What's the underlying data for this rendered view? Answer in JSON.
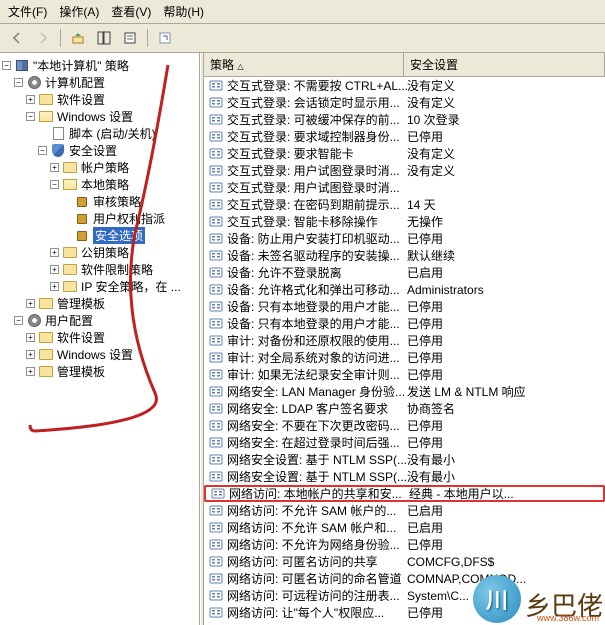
{
  "menu": {
    "file": "文件(F)",
    "action": "操作(A)",
    "view": "查看(V)",
    "help": "帮助(H)"
  },
  "tree": {
    "root": "\"本地计算机\" 策略",
    "computer": "计算机配置",
    "sw1": "软件设置",
    "win1": "Windows 设置",
    "script": "脚本 (启动/关机)",
    "sec": "安全设置",
    "acct": "帐户策略",
    "local": "本地策略",
    "audit": "审核策略",
    "rights": "用户权利指派",
    "secopt": "安全选项",
    "pubkey": "公钥策略",
    "swres": "软件限制策略",
    "ipsec": "IP 安全策略，在 ...",
    "admin1": "管理模板",
    "user": "用户配置",
    "sw2": "软件设置",
    "win2": "Windows 设置",
    "admin2": "管理模板"
  },
  "columns": {
    "policy": "策略  ",
    "setting": "安全设置"
  },
  "rows": [
    {
      "name": "交互式登录: 不需要按 CTRL+AL...",
      "val": "没有定义"
    },
    {
      "name": "交互式登录: 会话锁定时显示用...",
      "val": "没有定义"
    },
    {
      "name": "交互式登录: 可被缓冲保存的前...",
      "val": "10 次登录"
    },
    {
      "name": "交互式登录: 要求域控制器身份...",
      "val": "已停用"
    },
    {
      "name": "交互式登录: 要求智能卡",
      "val": "没有定义"
    },
    {
      "name": "交互式登录: 用户试图登录时消...",
      "val": "没有定义"
    },
    {
      "name": "交互式登录: 用户试图登录时消...",
      "val": ""
    },
    {
      "name": "交互式登录: 在密码到期前提示...",
      "val": "14 天"
    },
    {
      "name": "交互式登录: 智能卡移除操作",
      "val": "无操作"
    },
    {
      "name": "设备: 防止用户安装打印机驱动...",
      "val": "已停用"
    },
    {
      "name": "设备: 未签名驱动程序的安装操...",
      "val": "默认继续"
    },
    {
      "name": "设备: 允许不登录脱离",
      "val": "已启用"
    },
    {
      "name": "设备: 允许格式化和弹出可移动...",
      "val": "Administrators"
    },
    {
      "name": "设备: 只有本地登录的用户才能...",
      "val": "已停用"
    },
    {
      "name": "设备: 只有本地登录的用户才能...",
      "val": "已停用"
    },
    {
      "name": "审计: 对备份和还原权限的使用...",
      "val": "已停用"
    },
    {
      "name": "审计: 对全局系统对象的访问进...",
      "val": "已停用"
    },
    {
      "name": "审计: 如果无法纪录安全审计则...",
      "val": "已停用"
    },
    {
      "name": "网络安全: LAN Manager 身份验...",
      "val": "发送 LM & NTLM 响应"
    },
    {
      "name": "网络安全: LDAP 客户签名要求",
      "val": "协商签名"
    },
    {
      "name": "网络安全: 不要在下次更改密码...",
      "val": "已停用"
    },
    {
      "name": "网络安全: 在超过登录时间后强...",
      "val": "已停用"
    },
    {
      "name": "网络安全设置: 基于 NTLM SSP(...",
      "val": "没有最小"
    },
    {
      "name": "网络安全设置: 基于 NTLM SSP(...",
      "val": "没有最小"
    },
    {
      "name": "网络访问: 本地帐户的共享和安...",
      "val": "经典 - 本地用户以...",
      "hl": true
    },
    {
      "name": "网络访问: 不允许 SAM 帐户的...",
      "val": "已启用"
    },
    {
      "name": "网络访问: 不允许 SAM 帐户和...",
      "val": "已启用"
    },
    {
      "name": "网络访问: 不允许为网络身份验...",
      "val": "已停用"
    },
    {
      "name": "网络访问: 可匿名访问的共享",
      "val": "COMCFG,DFS$"
    },
    {
      "name": "网络访问: 可匿名访问的命名管道",
      "val": "COMNAP,COMNOD..."
    },
    {
      "name": "网络访问: 可远程访问的注册表...",
      "val": "System\\C..."
    },
    {
      "name": "网络访问: 让\"每个人\"权限应...",
      "val": "已停用"
    }
  ],
  "watermark": {
    "disc": "川",
    "text": "乡巴佬",
    "url": "www.386w.com"
  }
}
